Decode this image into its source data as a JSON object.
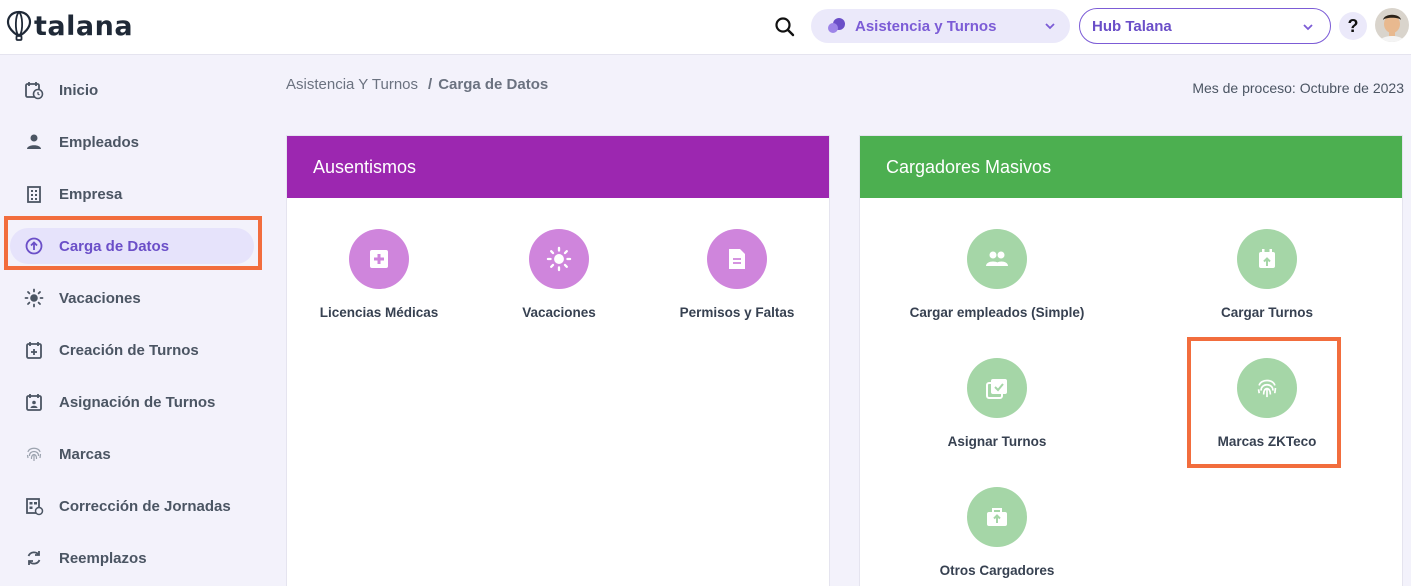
{
  "app": {
    "brand": "talana"
  },
  "topbar": {
    "module_selector": "Asistencia y Turnos",
    "hub_selector": "Hub Talana",
    "help": "?"
  },
  "sidebar": {
    "items": [
      {
        "label": "Inicio",
        "icon": "calendar-clock-icon"
      },
      {
        "label": "Empleados",
        "icon": "person-icon"
      },
      {
        "label": "Empresa",
        "icon": "building-icon"
      },
      {
        "label": "Carga de Datos",
        "icon": "upload-circle-icon",
        "active": true
      },
      {
        "label": "Vacaciones",
        "icon": "sun-icon"
      },
      {
        "label": "Creación de Turnos",
        "icon": "calendar-plus-icon"
      },
      {
        "label": "Asignación de Turnos",
        "icon": "calendar-person-icon"
      },
      {
        "label": "Marcas",
        "icon": "fingerprint-icon"
      },
      {
        "label": "Corrección de Jornadas",
        "icon": "schedule-edit-icon"
      },
      {
        "label": "Reemplazos",
        "icon": "sync-icon"
      }
    ]
  },
  "breadcrumb": {
    "parent": "Asistencia Y Turnos",
    "separator": "/",
    "current": "Carga de Datos"
  },
  "process_month": "Mes de proceso: Octubre de 2023",
  "ausentismos": {
    "title": "Ausentismos",
    "color": "#9c27b0",
    "icon_color": "#cf85dc",
    "tiles": [
      {
        "label": "Licencias Médicas",
        "icon": "medical-plus-icon"
      },
      {
        "label": "Vacaciones",
        "icon": "sun-icon"
      },
      {
        "label": "Permisos y Faltas",
        "icon": "document-icon"
      }
    ]
  },
  "cargadores": {
    "title": "Cargadores Masivos",
    "color": "#4caf50",
    "icon_color": "#a5d6a7",
    "tiles": [
      {
        "label": "Cargar empleados (Simple)",
        "icon": "group-icon"
      },
      {
        "label": "Cargar Turnos",
        "icon": "calendar-upload-icon"
      },
      {
        "label": "Asignar Turnos",
        "icon": "calendar-check-stack-icon"
      },
      {
        "label": "Marcas ZKTeco",
        "icon": "fingerprint-icon"
      },
      {
        "label": "Otros Cargadores",
        "icon": "briefcase-upload-icon"
      }
    ]
  },
  "colors": {
    "accent": "#7c5cd6",
    "highlight": "#f26d3d"
  }
}
